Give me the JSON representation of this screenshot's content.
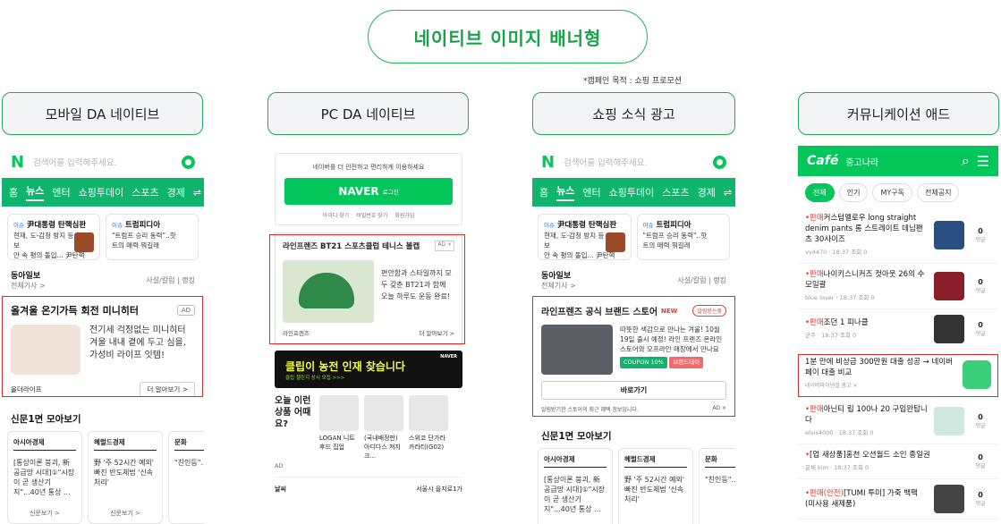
{
  "header": {
    "title": "네이티브 이미지 배너형"
  },
  "note": "*캠페인 목적 : 쇼핑 프로모션",
  "labels": [
    "모바일 DA 네이티브",
    "PC DA 네이티브",
    "쇼핑 소식 광고",
    "커뮤니케이션 애드"
  ],
  "mobile": {
    "search_placeholder": "검색어를 입력해주세요.",
    "tabs": [
      "홈",
      "뉴스",
      "엔터",
      "쇼핑투데이",
      "스포츠",
      "경제"
    ],
    "news": [
      {
        "tag": "이슈",
        "title": "尹대통령 탄핵심판",
        "line1": "현재, 도-감청 방지 등 철통보",
        "line2": "안 속 평의 돌입... 尹탄핵심..."
      },
      {
        "tag": "이슈",
        "title": "트럼피디아",
        "line1": "\"트럼프 승리 동력\"..핫",
        "line2": "트의 매력 뭐길래"
      }
    ],
    "press": {
      "name": "동아일보",
      "sub": "전체기사 >",
      "links": "사설/칼럼  |  랭킹"
    },
    "ad": {
      "title": "올겨울 온기가득 회전 미니히터",
      "badge": "AD",
      "text": "전기세 걱정없는 미니히터 겨울 내내 곁에 두고 심을, 가성비 라이프 잇템!",
      "brand": "올더라이프",
      "more": "더 알아보기 >"
    },
    "section": "신문1면 모아보기",
    "papers": [
      {
        "name": "아시아경제",
        "text": "[통상이론 붕괴, 新 공급망 시대]①\"시장이 곧 생산기지\"...40년 통상 ...",
        "foot": "신문보기 >"
      },
      {
        "name": "헤럴드경제",
        "text": "野 '주 52시간 예외' 빠진 반도체법 '신속 처리'",
        "foot": "신문보기 >"
      },
      {
        "name": "문화",
        "text": "\"친인등\"...",
        "foot": ""
      }
    ]
  },
  "pc": {
    "login_text": "네이버를 더 안전하고 편리하게 이용하세요",
    "login_btn": "NAVER",
    "login_btn_sub": "로그인",
    "links": [
      "아이디 찾기",
      "비밀번호 찾기",
      "회원가입"
    ],
    "ad": {
      "title": "라인프렌즈 BT21 스포츠클럽 테니스 볼캡",
      "badge": "AD ×",
      "text": "편안함과 스타일까지 모두 갖춘 BT21과 함께 오늘 하루도 운동 완료!",
      "brand": "라인프렌즈",
      "more": "더 알아보기 >"
    },
    "banner": {
      "text": "클립이 농전 인재 찾습니다",
      "sub": "클립 챌린지 상시 모집 >>>",
      "nv": "NAVER"
    },
    "shop": {
      "head": "오늘 이런 상품 어때요?",
      "items": [
        "LOGAN 니트 후드 집업",
        "(국내배정판) 아디다스 져지 크...",
        "스위코 단가라카라티(G02)"
      ],
      "ad": "AD"
    },
    "weather": {
      "left": "날씨",
      "right": "서울시 을지로1가"
    }
  },
  "shopping": {
    "search_placeholder": "검색어를 입력해주세요.",
    "ad": {
      "title": "라인프렌즈 공식 브랜드 스토어",
      "new": "NEW",
      "pill": "알림받는중",
      "text": "따뜻한 색감으로 만나는 겨울! 10월 19일 출시 예정! 라인 프렌즈 온라인 스토어와 오프라인 매장에서 만나요",
      "coupon": "COUPON 10%",
      "brand_day": "브랜드데이",
      "goto": "바로가기",
      "foot": "알림받기한 스토어의 최근 혜택 정보입니다.",
      "badge": "AD ×"
    },
    "section": "신문1면 모아보기"
  },
  "cafe": {
    "logo": "Café",
    "name": "중고나라",
    "tabs": [
      "전체",
      "인기",
      "MY구독",
      "전체공지"
    ],
    "posts": [
      {
        "pre": "•판매",
        "title": "커스텀멜로우 long straight denim pants 롱 스트레이트 데님팬츠 30사이즈",
        "meta": "vv4470 · 18:37 조회 0",
        "count": "0"
      },
      {
        "pre": "•판매",
        "title": "나이키스니커즈 컷아웃 26의 수모일괄",
        "meta": "blue lover · 18:37 조회 0",
        "count": "0"
      },
      {
        "pre": "•판매",
        "title": "조던 1 피나클",
        "meta": "군주 · 18:37 조회 0",
        "count": "0"
      }
    ],
    "ad": {
      "text": "1분 만에 비상금 300만원 대출 성공 → 네이버페이 대출 비교",
      "label": "네이버파이낸셜 광고 ×"
    },
    "posts2": [
      {
        "pre": "•판매",
        "title": "아닌티 립 100나 20 구입완탑니다",
        "meta": "elvis4000 · 18:37 조회 0",
        "count": "0"
      },
      {
        "pre": "•",
        "title": "[업 새상품]홍천 오션월드 소인 종일권",
        "meta": "운체 kim · 18:37 조회 0",
        "count": "0"
      },
      {
        "pre": "•판매(안전)",
        "title": "[TUMI 투미] 가죽 백팩 (미사용 새제품)",
        "meta": "",
        "count": "0"
      }
    ]
  }
}
